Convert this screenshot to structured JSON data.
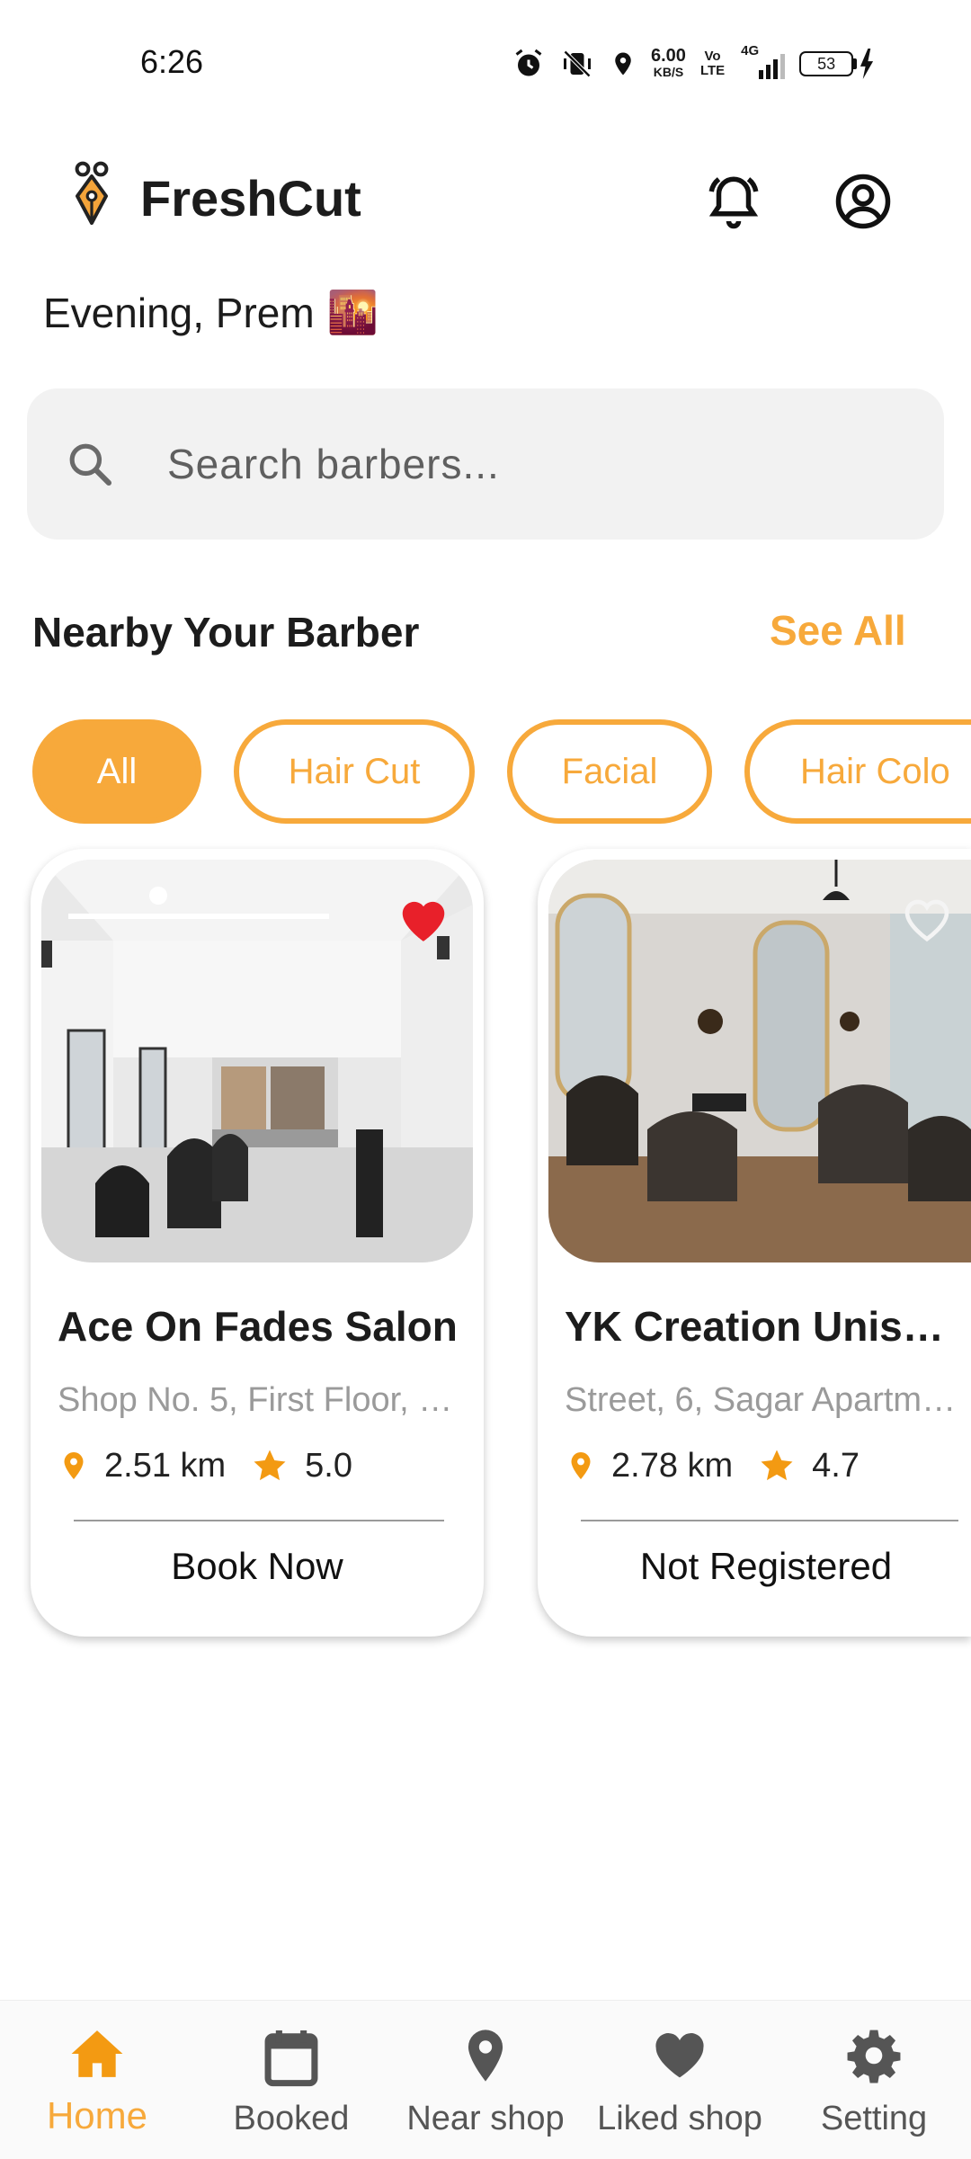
{
  "status_bar": {
    "time": "6:26",
    "net_speed_top": "6.00",
    "net_speed_bottom": "KB/S",
    "volte_top": "Vo",
    "volte_bottom": "LTE",
    "network": "4G",
    "battery": "53"
  },
  "header": {
    "app_title": "FreshCut",
    "logo_icon": "pen-nib-logo-icon",
    "bell_icon": "bell-icon",
    "account_icon": "account-circle-icon"
  },
  "greeting": {
    "text": "Evening, Prem",
    "emoji": "🌇"
  },
  "search": {
    "placeholder": "Search barbers...",
    "value": ""
  },
  "section": {
    "title": "Nearby Your Barber",
    "see_all": "See All"
  },
  "filters": [
    "All",
    "Hair Cut",
    "Facial",
    "Hair Colo"
  ],
  "cards": [
    {
      "name": "Ace On Fades Salon",
      "address": "Shop No. 5, First Floor, …",
      "distance": "2.51 km",
      "rating": "5.0",
      "action": "Book Now",
      "liked": true
    },
    {
      "name": "YK Creation Unise…",
      "address": "Street, 6, Sagar Apartm…",
      "distance": "2.78 km",
      "rating": "4.7",
      "action": "Not Registered",
      "liked": false
    }
  ],
  "nav": [
    {
      "label": "Home",
      "icon": "home-icon",
      "active": true
    },
    {
      "label": "Booked",
      "icon": "calendar-icon",
      "active": false
    },
    {
      "label": "Near shop",
      "icon": "location-pin-icon",
      "active": false
    },
    {
      "label": "Liked shop",
      "icon": "heart-icon",
      "active": false
    },
    {
      "label": "Setting",
      "icon": "gear-icon",
      "active": false
    }
  ],
  "colors": {
    "accent": "#f7a93b",
    "heart_red": "#e8202a",
    "text": "#1c1c1c",
    "muted": "#9a9a9a"
  }
}
